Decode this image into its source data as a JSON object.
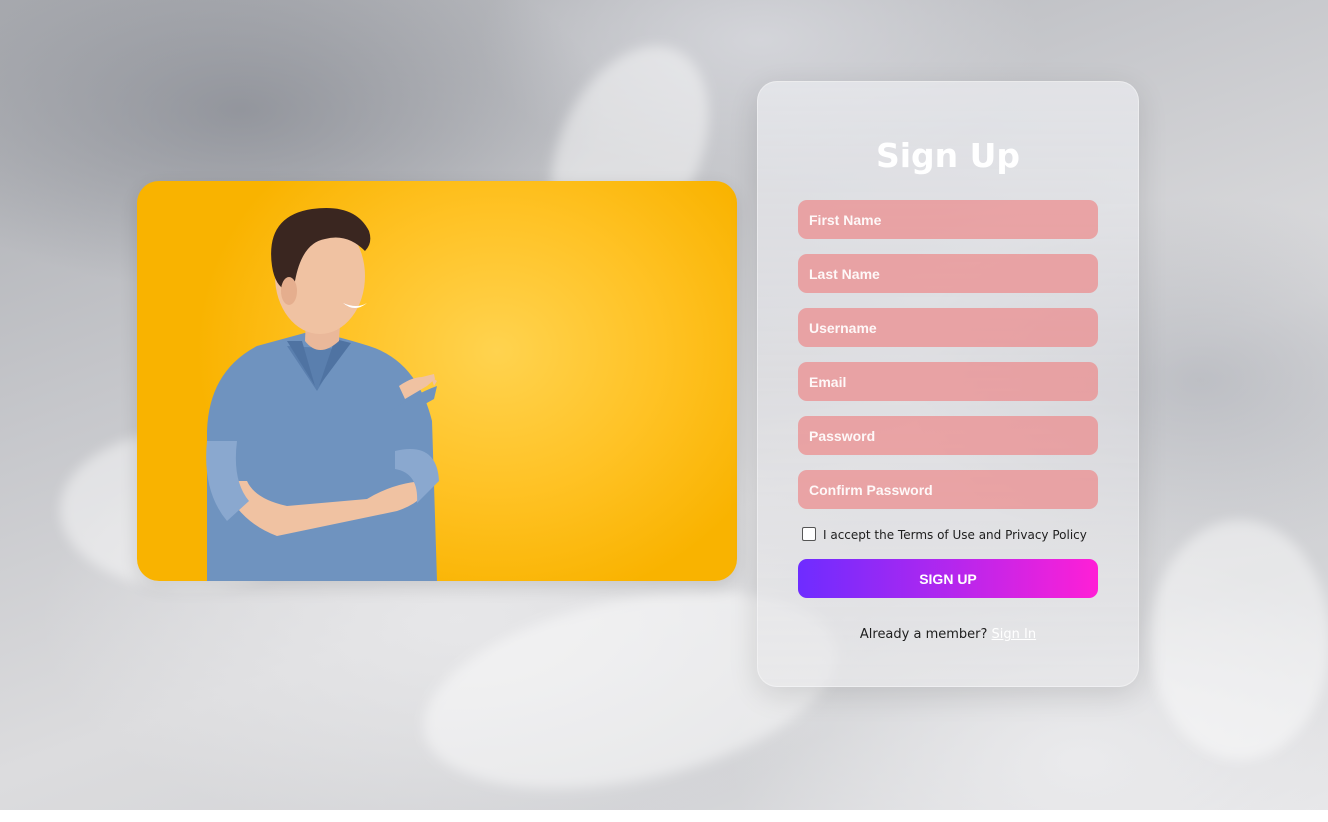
{
  "form": {
    "title": "Sign Up",
    "fields": [
      {
        "placeholder": "First Name"
      },
      {
        "placeholder": "Last Name"
      },
      {
        "placeholder": "Username"
      },
      {
        "placeholder": "Email"
      },
      {
        "placeholder": "Password"
      },
      {
        "placeholder": "Confirm Password"
      }
    ],
    "terms_label": "I accept the Terms of Use and Privacy Policy",
    "terms_checked": false,
    "submit_label": "SIGN UP",
    "member_prompt": "Already a member?",
    "signin_link": "Sign In"
  },
  "colors": {
    "field_bg": "#eb8a8c",
    "button_gradient_start": "#6e2cff",
    "button_gradient_end": "#ff1fd6",
    "photo_bg": "#ffc224"
  }
}
